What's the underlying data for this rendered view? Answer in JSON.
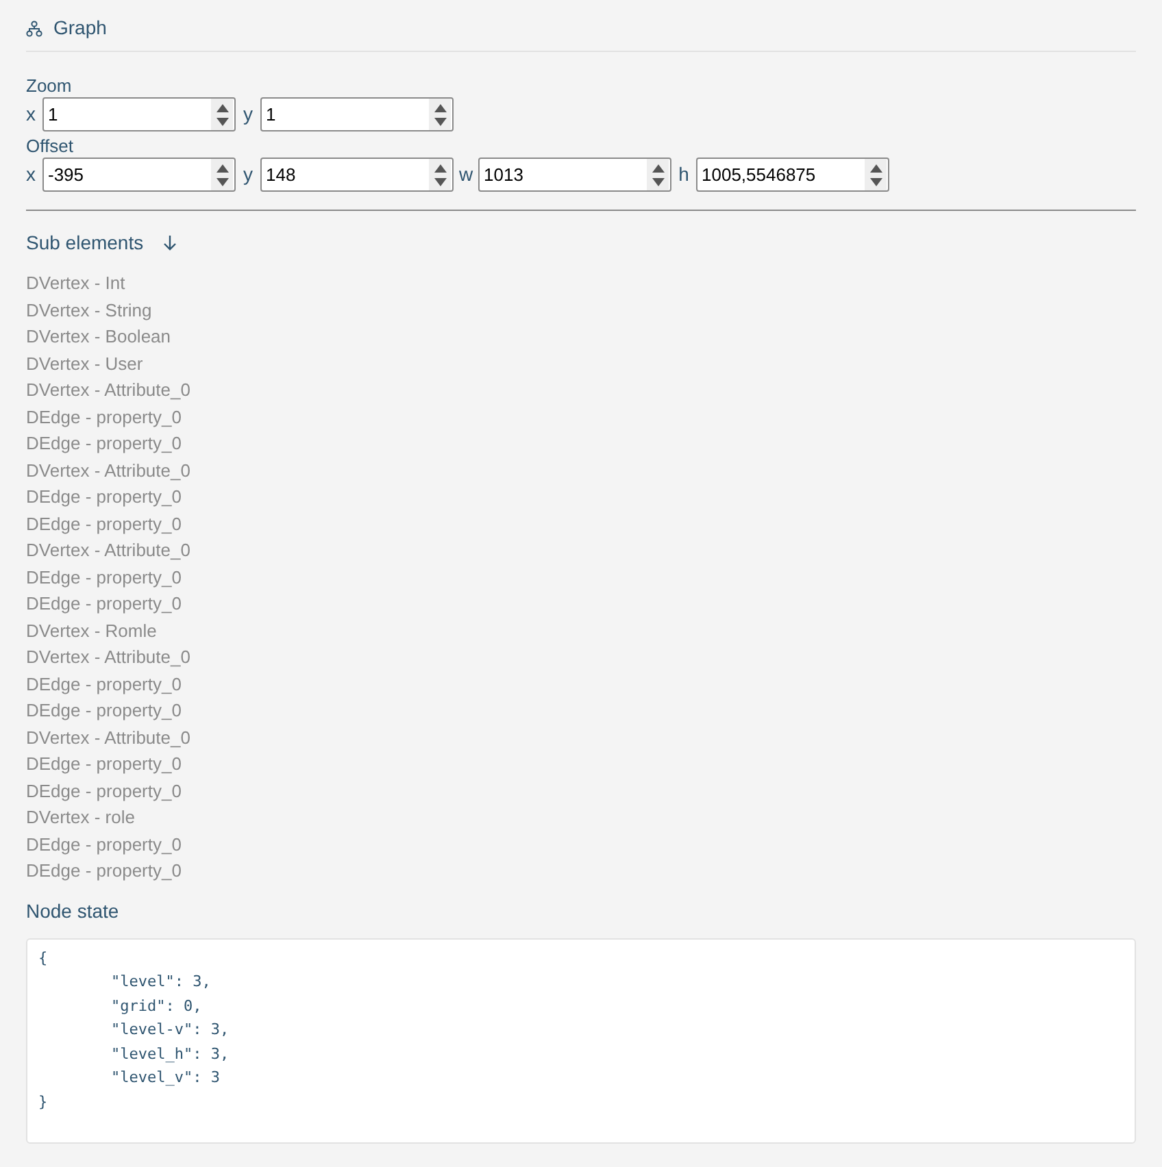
{
  "header": {
    "title": "Graph"
  },
  "zoom": {
    "label": "Zoom",
    "fields": [
      {
        "label": "x",
        "value": "1"
      },
      {
        "label": "y",
        "value": "1"
      }
    ]
  },
  "offset": {
    "label": "Offset",
    "fields": [
      {
        "label": "x",
        "value": "-395"
      },
      {
        "label": "y",
        "value": "148"
      },
      {
        "label": "w",
        "value": "1013"
      },
      {
        "label": "h",
        "value": "1005,5546875"
      }
    ]
  },
  "sub_elements": {
    "title": "Sub elements",
    "items": [
      "DVertex - Int",
      "DVertex - String",
      "DVertex - Boolean",
      "DVertex - User",
      "DVertex - Attribute_0",
      "DEdge - property_0",
      "DEdge - property_0",
      "DVertex - Attribute_0",
      "DEdge - property_0",
      "DEdge - property_0",
      "DVertex - Attribute_0",
      "DEdge - property_0",
      "DEdge - property_0",
      "DVertex - Romle",
      "DVertex - Attribute_0",
      "DEdge - property_0",
      "DEdge - property_0",
      "DVertex - Attribute_0",
      "DEdge - property_0",
      "DEdge - property_0",
      "DVertex - role",
      "DEdge - property_0",
      "DEdge - property_0"
    ]
  },
  "node_state": {
    "title": "Node state",
    "code": "{\n\t\"level\": 3,\n\t\"grid\": 0,\n\t\"level-v\": 3,\n\t\"level_h\": 3,\n\t\"level_v\": 3\n}"
  }
}
